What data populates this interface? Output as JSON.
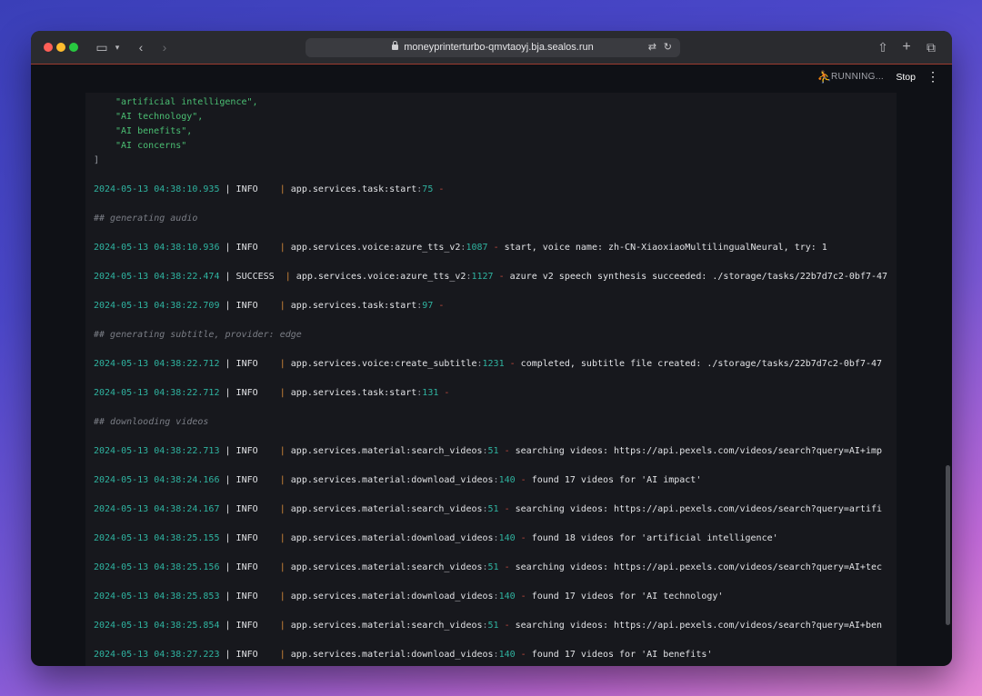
{
  "browser": {
    "url": "moneyprinterturbo-qmvtaoyj.bja.sealos.run"
  },
  "app": {
    "status": "RUNNING...",
    "stop_label": "Stop"
  },
  "log_head": {
    "l1": "\"artificial intelligence\",",
    "l2": "\"AI technology\",",
    "l3": "\"AI benefits\",",
    "l4": "\"AI concerns\"",
    "l5": "]"
  },
  "entries": [
    {
      "ts": "2024-05-13 04:38:10.935",
      "level": "INFO",
      "mod": "app.services.task:start",
      "line": "75",
      "msg": ""
    },
    {
      "ts": "2024-05-13 04:38:10.936",
      "level": "INFO",
      "mod": "app.services.voice:azure_tts_v2",
      "line": "1087",
      "msg": "start, voice name: zh-CN-XiaoxiaoMultilingualNeural, try: 1"
    },
    {
      "ts": "2024-05-13 04:38:22.474",
      "level": "SUCCESS",
      "mod": "app.services.voice:azure_tts_v2",
      "line": "1127",
      "msg": "azure v2 speech synthesis succeeded: ./storage/tasks/22b7d7c2-0bf7-47"
    },
    {
      "ts": "2024-05-13 04:38:22.709",
      "level": "INFO",
      "mod": "app.services.task:start",
      "line": "97",
      "msg": ""
    },
    {
      "ts": "2024-05-13 04:38:22.712",
      "level": "INFO",
      "mod": "app.services.voice:create_subtitle",
      "line": "1231",
      "msg": "completed, subtitle file created: ./storage/tasks/22b7d7c2-0bf7-47"
    },
    {
      "ts": "2024-05-13 04:38:22.712",
      "level": "INFO",
      "mod": "app.services.task:start",
      "line": "131",
      "msg": ""
    },
    {
      "ts": "2024-05-13 04:38:22.713",
      "level": "INFO",
      "mod": "app.services.material:search_videos",
      "line": "51",
      "msg": "searching videos: https://api.pexels.com/videos/search?query=AI+imp"
    },
    {
      "ts": "2024-05-13 04:38:24.166",
      "level": "INFO",
      "mod": "app.services.material:download_videos",
      "line": "140",
      "msg": "found 17 videos for 'AI impact'"
    },
    {
      "ts": "2024-05-13 04:38:24.167",
      "level": "INFO",
      "mod": "app.services.material:search_videos",
      "line": "51",
      "msg": "searching videos: https://api.pexels.com/videos/search?query=artifi"
    },
    {
      "ts": "2024-05-13 04:38:25.155",
      "level": "INFO",
      "mod": "app.services.material:download_videos",
      "line": "140",
      "msg": "found 18 videos for 'artificial intelligence'"
    },
    {
      "ts": "2024-05-13 04:38:25.156",
      "level": "INFO",
      "mod": "app.services.material:search_videos",
      "line": "51",
      "msg": "searching videos: https://api.pexels.com/videos/search?query=AI+tec"
    },
    {
      "ts": "2024-05-13 04:38:25.853",
      "level": "INFO",
      "mod": "app.services.material:download_videos",
      "line": "140",
      "msg": "found 17 videos for 'AI technology'"
    },
    {
      "ts": "2024-05-13 04:38:25.854",
      "level": "INFO",
      "mod": "app.services.material:search_videos",
      "line": "51",
      "msg": "searching videos: https://api.pexels.com/videos/search?query=AI+ben"
    },
    {
      "ts": "2024-05-13 04:38:27.223",
      "level": "INFO",
      "mod": "app.services.material:download_videos",
      "line": "140",
      "msg": "found 17 videos for 'AI benefits'"
    }
  ],
  "comments": {
    "audio": "## generating audio",
    "subtitle": "## generating subtitle, provider: edge",
    "videos": "## downlooding videos"
  }
}
